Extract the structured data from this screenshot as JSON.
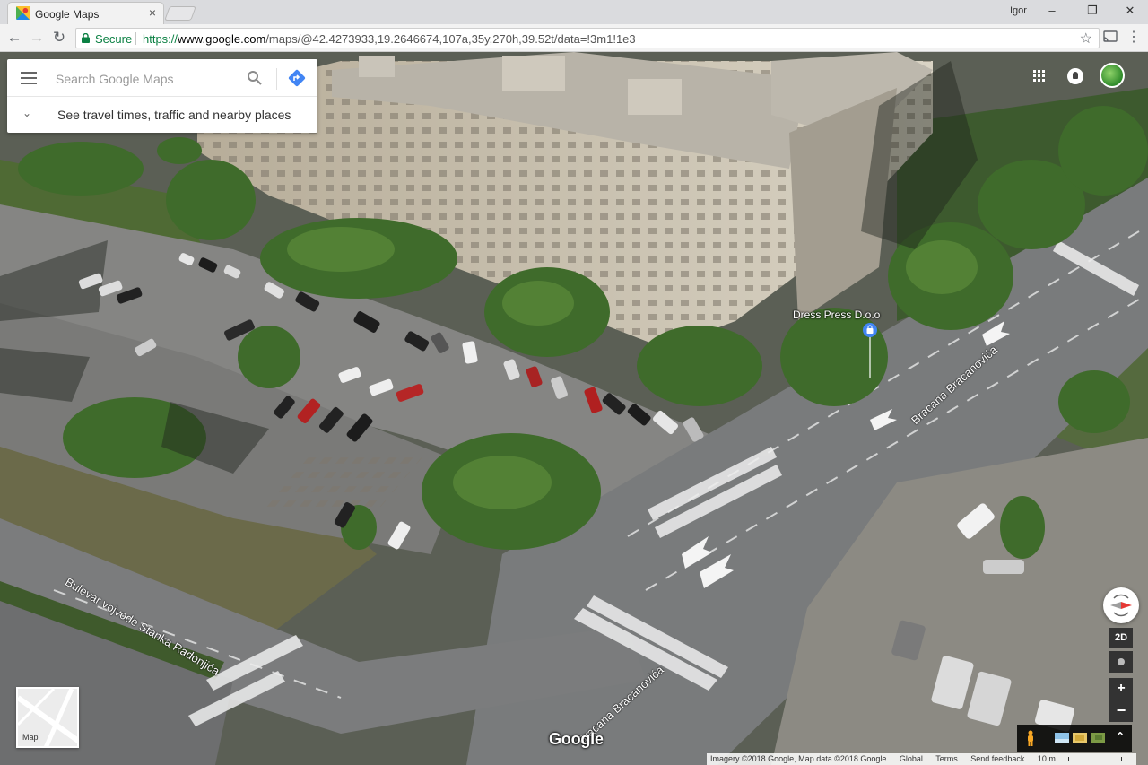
{
  "browser": {
    "tab_title": "Google Maps",
    "tab_close": "×",
    "user_name": "Igor",
    "window_controls": {
      "minimize": "–",
      "maximize": "❐",
      "close": "✕"
    },
    "nav": {
      "back": "←",
      "forward": "→",
      "reload": "↻"
    },
    "secure_label": "Secure",
    "url_scheme": "https://",
    "url_host": "www.google.com",
    "url_path": "/maps/@42.4273933,19.2646674,107a,35y,270h,39.52t/data=!3m1!1e3",
    "bookmark_star": "☆",
    "menu": "⋮"
  },
  "search": {
    "placeholder": "Search Google Maps",
    "value": "",
    "travel_toggle": "See travel times, traffic and nearby places",
    "travel_chevron": "⌄"
  },
  "map": {
    "view": "satellite-3d",
    "streets": [
      "Bracana Bracanovića",
      "Bulevar vojvode Stanka Radonjića",
      "Bracana Bracanovića"
    ],
    "poi": {
      "name": "Dress Press D.o.o",
      "icon": "shopping-bag-icon",
      "color": "#4285f4"
    }
  },
  "controls": {
    "minimap_label": "Map",
    "view_mode": "2D",
    "zoom_in": "+",
    "zoom_out": "−",
    "tray_expand": "⌃",
    "logo": "Google"
  },
  "footer": {
    "imagery": "Imagery ©2018 Google, Map data ©2018 Google",
    "global": "Global",
    "terms": "Terms",
    "feedback": "Send feedback",
    "scale": "10 m"
  },
  "colors": {
    "secure": "#0b8043",
    "brand_blue": "#4285f4",
    "compass_red": "#e53935"
  }
}
